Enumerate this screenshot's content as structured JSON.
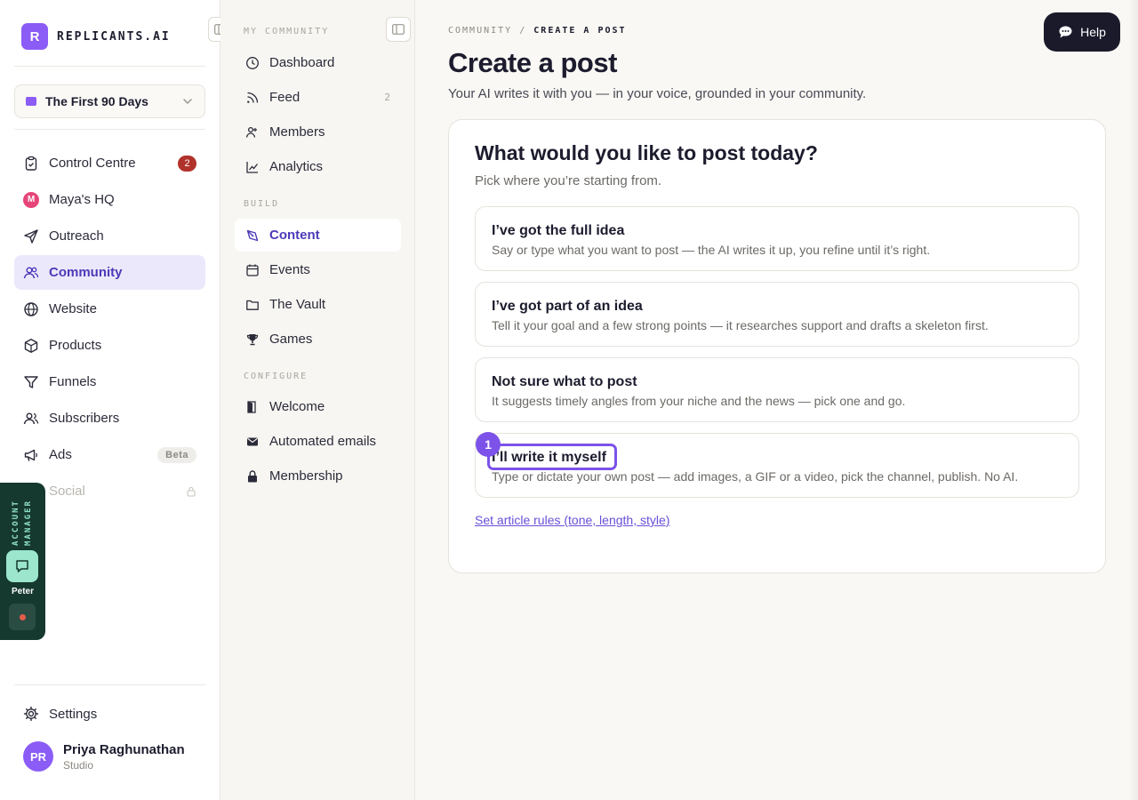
{
  "brand": {
    "logo_letter": "R",
    "name": "REPLICANTS.AI"
  },
  "workspace": {
    "name": "The First 90 Days"
  },
  "primary_nav": [
    {
      "label": "Control Centre",
      "icon": "clipboard-icon",
      "badge": "2"
    },
    {
      "label": "Maya's HQ",
      "icon": "maya-avatar-icon",
      "icon_letter": "M"
    },
    {
      "label": "Outreach",
      "icon": "send-icon"
    },
    {
      "label": "Community",
      "icon": "users-icon",
      "active": true
    },
    {
      "label": "Website",
      "icon": "globe-icon"
    },
    {
      "label": "Products",
      "icon": "box-icon"
    },
    {
      "label": "Funnels",
      "icon": "filter-icon"
    },
    {
      "label": "Subscribers",
      "icon": "user-group-icon"
    },
    {
      "label": "Ads",
      "icon": "megaphone-icon",
      "tag": "Beta"
    },
    {
      "label": "Social",
      "icon": "social-icon",
      "locked": true
    }
  ],
  "settings": {
    "label": "Settings"
  },
  "user": {
    "initials": "PR",
    "name": "Priya Raghunathan",
    "plan": "Studio"
  },
  "account_manager": {
    "label": "ACCOUNT MANAGER",
    "name": "Peter"
  },
  "secondary_nav": {
    "section_my_community": "MY COMMUNITY",
    "section_build": "BUILD",
    "section_configure": "CONFIGURE",
    "my_community": [
      {
        "label": "Dashboard"
      },
      {
        "label": "Feed",
        "count": "2"
      },
      {
        "label": "Members"
      },
      {
        "label": "Analytics"
      }
    ],
    "build": [
      {
        "label": "Content",
        "active": true
      },
      {
        "label": "Events"
      },
      {
        "label": "The Vault"
      },
      {
        "label": "Games"
      }
    ],
    "configure": [
      {
        "label": "Welcome"
      },
      {
        "label": "Automated emails"
      },
      {
        "label": "Membership"
      }
    ]
  },
  "header": {
    "breadcrumb_parent": "COMMUNITY",
    "breadcrumb_sep": "/",
    "breadcrumb_current": "CREATE A POST",
    "title": "Create a post",
    "subtitle": "Your AI writes it with you — in your voice, grounded in your community.",
    "help_label": "Help"
  },
  "card": {
    "title": "What would you like to post today?",
    "subtitle": "Pick where you’re starting from.",
    "options": [
      {
        "title": "I’ve got the full idea",
        "desc": "Say or type what you want to post — the AI writes it up, you refine until it’s right."
      },
      {
        "title": "I’ve got part of an idea",
        "desc": "Tell it your goal and a few strong points — it researches support and drafts a skeleton first."
      },
      {
        "title": "Not sure what to post",
        "desc": "It suggests timely angles from your niche and the news — pick one and go."
      },
      {
        "title": "I’ll write it myself",
        "desc": "Type or dictate your own post — add images, a GIF or a video, pick the channel, publish. No AI.",
        "step": "1"
      }
    ],
    "rules_link": "Set article rules (tone, length, style)"
  },
  "colors": {
    "accent": "#7c52e8",
    "brand": "#8b5cf6",
    "badge_red": "#b0322b",
    "account_manager_bg": "#15382f"
  }
}
